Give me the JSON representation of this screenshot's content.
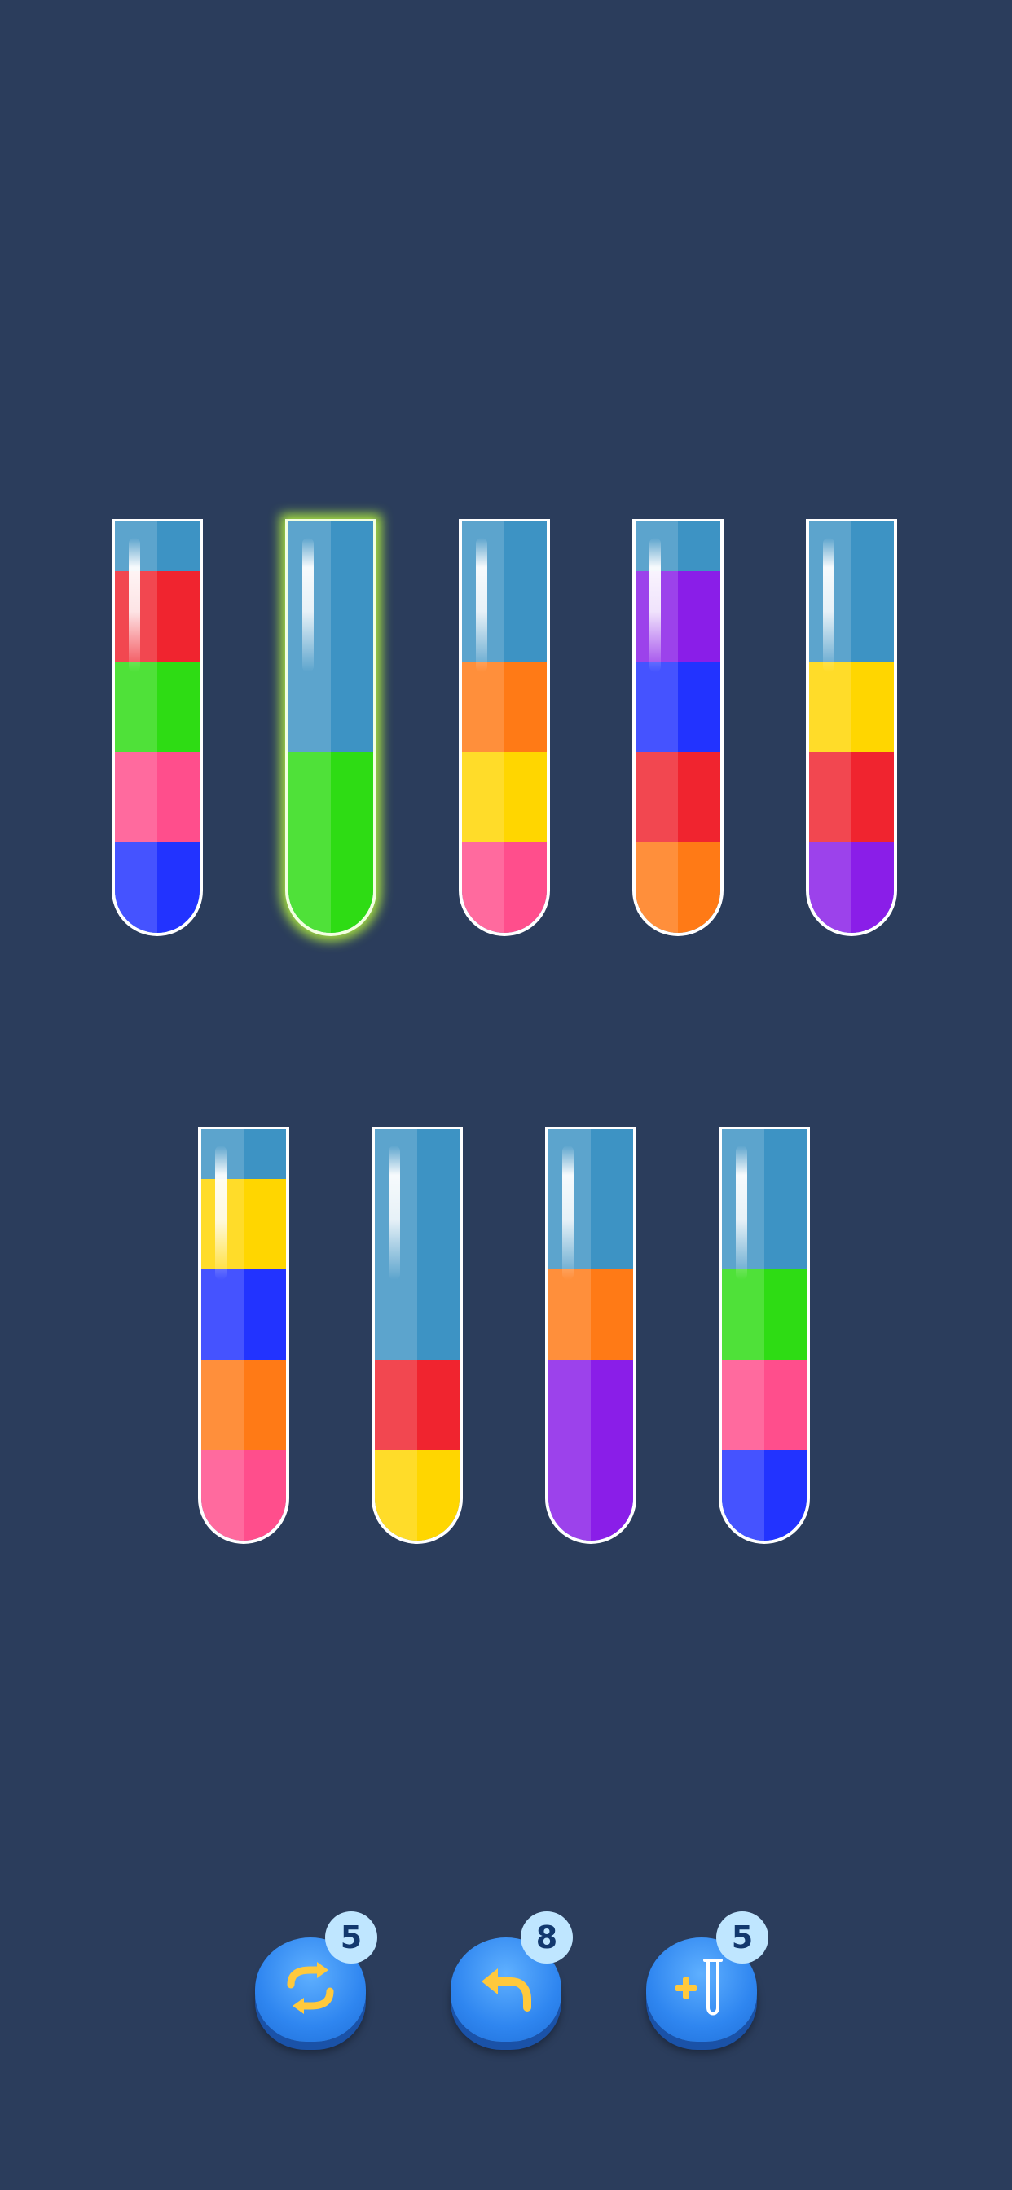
{
  "colors": {
    "background": "#2b3d5c",
    "empty": "#3d93c4",
    "red": "#f0242f",
    "green": "#2edc14",
    "pink": "#ff4e8c",
    "blue": "#2233ff",
    "orange": "#ff7a16",
    "yellow": "#ffd600",
    "purple": "#8a1ee8"
  },
  "tubes": [
    {
      "layers": [
        "red",
        "green",
        "pink",
        "blue"
      ],
      "selected": false
    },
    {
      "layers": [
        "green",
        "green"
      ],
      "selected": true
    },
    {
      "layers": [
        "orange",
        "yellow",
        "pink"
      ],
      "selected": false
    },
    {
      "layers": [
        "purple",
        "blue",
        "red",
        "orange"
      ],
      "selected": false
    },
    {
      "layers": [
        "yellow",
        "red",
        "purple"
      ],
      "selected": false
    },
    {
      "layers": [
        "yellow",
        "blue",
        "orange",
        "pink"
      ],
      "selected": false
    },
    {
      "layers": [
        "red",
        "yellow"
      ],
      "selected": false
    },
    {
      "layers": [
        "orange",
        "purple",
        "purple"
      ],
      "selected": false
    },
    {
      "layers": [
        "green",
        "pink",
        "blue"
      ],
      "selected": false
    }
  ],
  "toolbar": {
    "shuffle": {
      "icon": "shuffle-icon",
      "count": "5"
    },
    "undo": {
      "icon": "undo-icon",
      "count": "8"
    },
    "add_tube": {
      "icon": "add-tube-icon",
      "count": "5"
    }
  }
}
